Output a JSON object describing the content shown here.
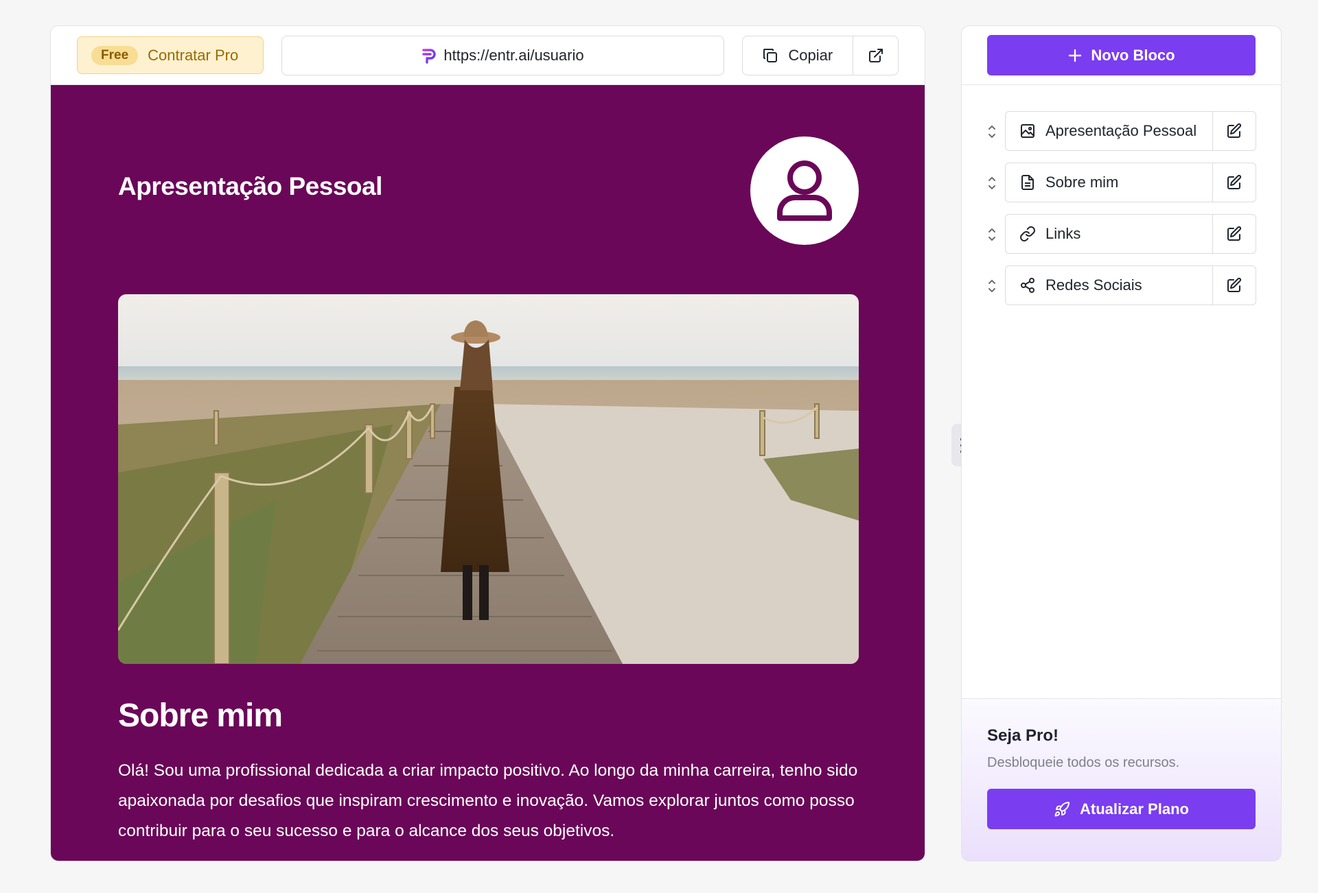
{
  "topbar": {
    "free_badge": "Free",
    "pro_link": "Contratar Pro",
    "url": "https://entr.ai/usuario",
    "copy_label": "Copiar"
  },
  "preview": {
    "hero_title": "Apresentação Pessoal",
    "about_title": "Sobre mim",
    "about_text": "Olá! Sou uma profissional dedicada a criar impacto positivo. Ao longo da minha carreira, tenho sido apaixonada por desafios que inspiram crescimento e inovação. Vamos explorar juntos como posso contribuir para o seu sucesso e para o alcance dos seus objetivos."
  },
  "sidebar": {
    "new_block_label": "Novo Bloco",
    "blocks": [
      {
        "label": "Apresentação Pessoal",
        "icon": "image-icon"
      },
      {
        "label": "Sobre mim",
        "icon": "document-icon"
      },
      {
        "label": "Links",
        "icon": "link-icon"
      },
      {
        "label": "Redes Sociais",
        "icon": "share-icon"
      }
    ],
    "pro_title": "Seja Pro!",
    "pro_subtitle": "Desbloqueie todos os recursos.",
    "upgrade_label": "Atualizar Plano"
  },
  "colors": {
    "brand": "#7a3df0",
    "canvas": "#6a0758",
    "pro_badge": "#fdf1cf"
  }
}
